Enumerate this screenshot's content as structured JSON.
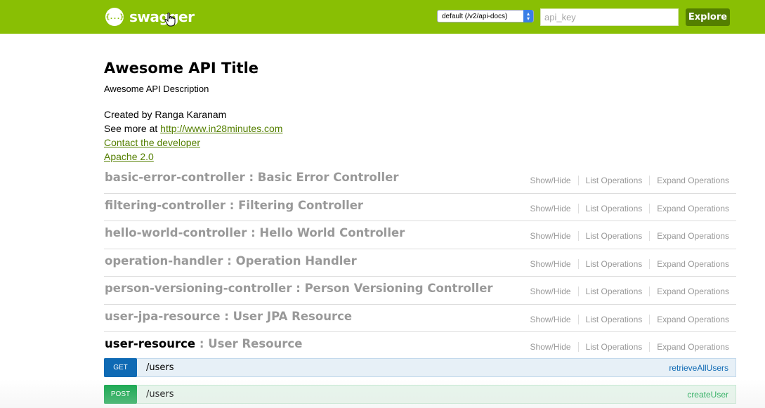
{
  "header": {
    "logo_icon_text": "{...}",
    "logo_text": "swagger",
    "spec_select_value": "default (/v2/api-docs)",
    "api_key_placeholder": "api_key",
    "explore_label": "Explore",
    "bar_color": "#89bf04"
  },
  "info": {
    "title": "Awesome API Title",
    "description": "Awesome API Description",
    "created_by": "Created by Ranga Karanam",
    "see_more_prefix": "See more at ",
    "see_more_link": "http://www.in28minutes.com",
    "contact_link": "Contact the developer",
    "license_link": "Apache 2.0"
  },
  "resource_actions": {
    "show_hide": "Show/Hide",
    "list_operations": "List Operations",
    "expand_operations": "Expand Operations"
  },
  "resources": [
    {
      "path": "basic-error-controller",
      "separator": " : ",
      "description": "Basic Error Controller"
    },
    {
      "path": "filtering-controller",
      "separator": " : ",
      "description": "Filtering Controller"
    },
    {
      "path": "hello-world-controller",
      "separator": " : ",
      "description": "Hello World Controller"
    },
    {
      "path": "operation-handler",
      "separator": " : ",
      "description": "Operation Handler"
    },
    {
      "path": "person-versioning-controller",
      "separator": " : ",
      "description": "Person Versioning Controller"
    },
    {
      "path": "user-jpa-resource",
      "separator": " : ",
      "description": "User JPA Resource"
    },
    {
      "path": "user-resource",
      "separator": " : ",
      "description": "User Resource"
    }
  ],
  "operations": [
    {
      "method": "GET",
      "path": "/users",
      "nickname": "retrieveAllUsers",
      "color": "#0f6ab4"
    },
    {
      "method": "POST",
      "path": "/users",
      "nickname": "createUser",
      "color": "#10a54a"
    }
  ]
}
